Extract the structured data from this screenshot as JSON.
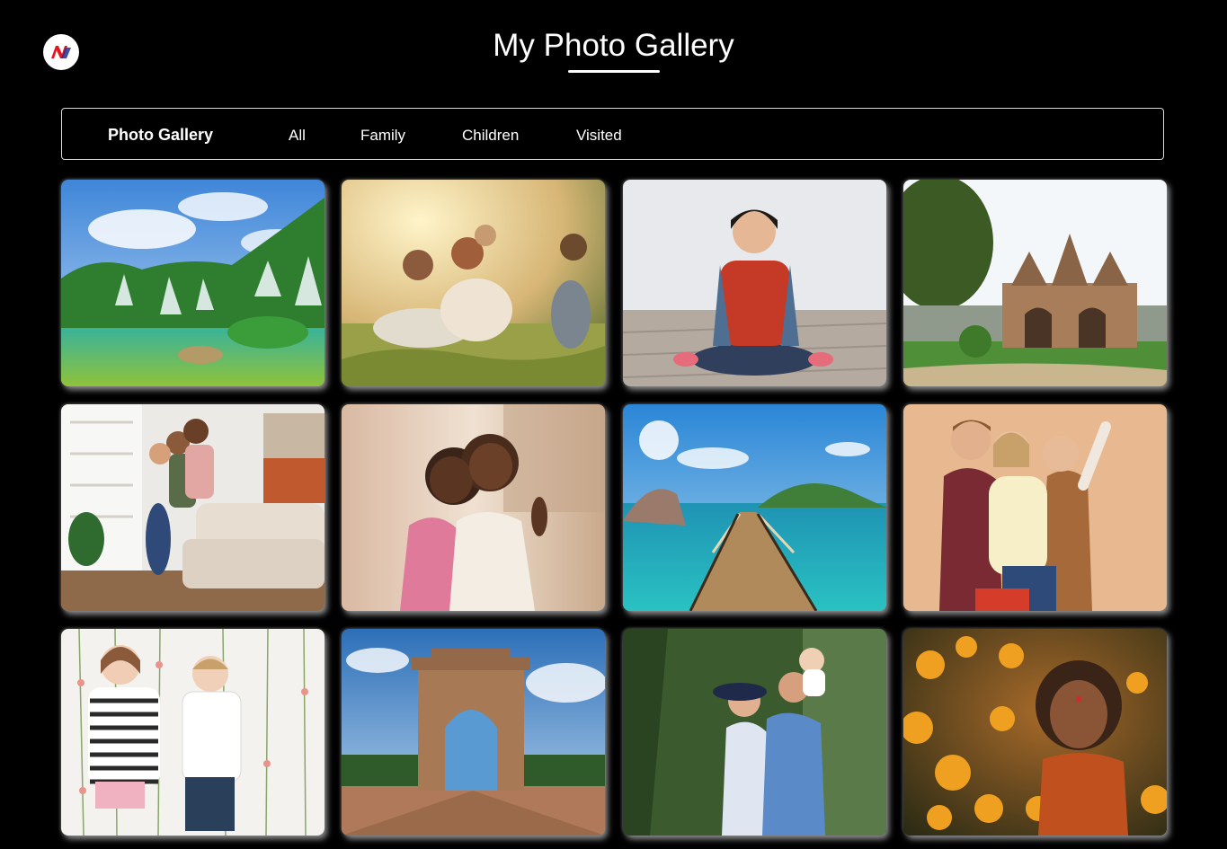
{
  "header": {
    "logo_icon": "nv-logo-icon",
    "title": "My Photo Gallery"
  },
  "nav": {
    "brand": "Photo Gallery",
    "links": [
      "All",
      "Family",
      "Children",
      "Visited"
    ]
  },
  "gallery": {
    "photos": [
      "waterfall-landscape-photo",
      "family-picnic-photo",
      "girl-sitting-photo",
      "stone-temple-photo",
      "family-on-sofa-photo",
      "two-boys-hugging-photo",
      "boardwalk-island-photo",
      "family-pointing-photo",
      "girl-and-boy-holding-hands-photo",
      "india-gate-photo",
      "couple-with-baby-photo",
      "girl-with-flowers-photo"
    ]
  }
}
